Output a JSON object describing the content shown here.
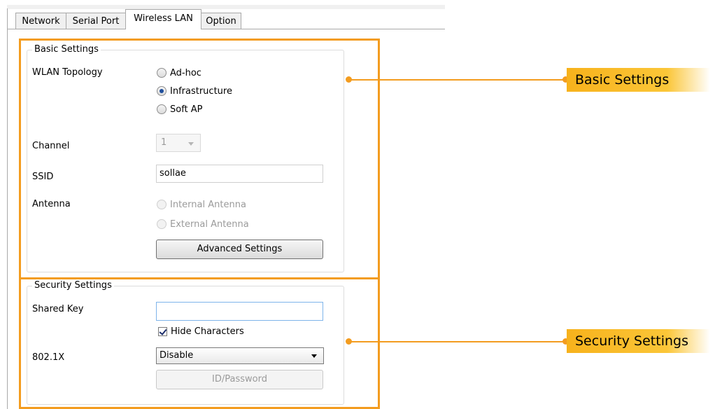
{
  "tabs": [
    {
      "label": "Network",
      "active": false
    },
    {
      "label": "Serial Port",
      "active": false
    },
    {
      "label": "Wireless LAN",
      "active": true
    },
    {
      "label": "Option",
      "active": false
    }
  ],
  "basic": {
    "title": "Basic Settings",
    "topology_label": "WLAN Topology",
    "topology_options": [
      "Ad-hoc",
      "Infrastructure",
      "Soft AP"
    ],
    "topology_selected": "Infrastructure",
    "channel_label": "Channel",
    "channel_value": "1",
    "ssid_label": "SSID",
    "ssid_value": "sollae",
    "antenna_label": "Antenna",
    "antenna_options": [
      "Internal Antenna",
      "External Antenna"
    ],
    "advanced_button": "Advanced Settings"
  },
  "security": {
    "title": "Security Settings",
    "shared_key_label": "Shared Key",
    "shared_key_value": "",
    "hide_chars_label": "Hide Characters",
    "hide_chars_checked": true,
    "dot1x_label": "802.1X",
    "dot1x_value": "Disable",
    "idpw_button": "ID/Password"
  },
  "callouts": {
    "basic": "Basic Settings",
    "security": "Security Settings"
  },
  "colors": {
    "callout_accent": "#f39c1f"
  }
}
